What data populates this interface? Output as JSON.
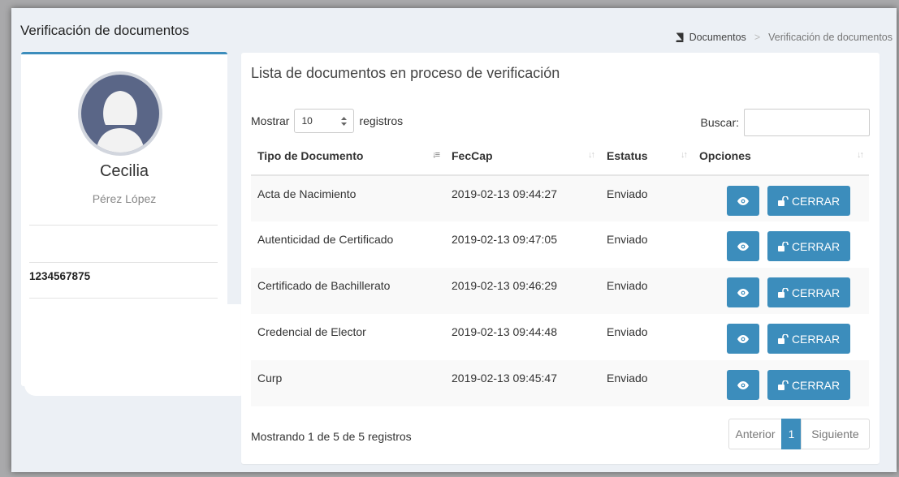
{
  "header": {
    "page_title": "Verificación de documentos",
    "breadcrumb": [
      "Documentos",
      "Verificación de documentos"
    ],
    "breadcrumb_separator": ">"
  },
  "profile": {
    "first_name": "Cecilia",
    "last_name": "Pérez López",
    "id_number": "1234567875"
  },
  "box": {
    "title": "Lista de documentos en proceso de verificación",
    "show_label": "Mostrar",
    "page_size": "10",
    "records_label": "registros",
    "search_label": "Buscar:",
    "search_value": ""
  },
  "table": {
    "headers": [
      "Tipo de Documento",
      "FecCap",
      "Estatus",
      "Opciones"
    ],
    "rows": [
      {
        "doc": "Acta de Nacimiento",
        "date": "2019-02-13 09:44:27",
        "status": "Enviado",
        "close": "CERRAR"
      },
      {
        "doc": "Autenticidad de Certificado",
        "date": "2019-02-13 09:47:05",
        "status": "Enviado",
        "close": "CERRAR"
      },
      {
        "doc": "Certificado de Bachillerato",
        "date": "2019-02-13 09:46:29",
        "status": "Enviado",
        "close": "CERRAR"
      },
      {
        "doc": "Credencial de Elector",
        "date": "2019-02-13 09:44:48",
        "status": "Enviado",
        "close": "CERRAR"
      },
      {
        "doc": "Curp",
        "date": "2019-02-13 09:45:47",
        "status": "Enviado",
        "close": "CERRAR"
      }
    ]
  },
  "footer": {
    "info": "Mostrando 1 de 5 de 5 registros",
    "prev": "Anterior",
    "page": "1",
    "next": "Siguiente"
  },
  "colors": {
    "accent": "#3c8dbc",
    "avatar": "#5a6687"
  },
  "icons": [
    "book-icon",
    "female-user-icon",
    "select-arrows-icon",
    "sort-icon",
    "eye-icon",
    "unlock-icon"
  ]
}
